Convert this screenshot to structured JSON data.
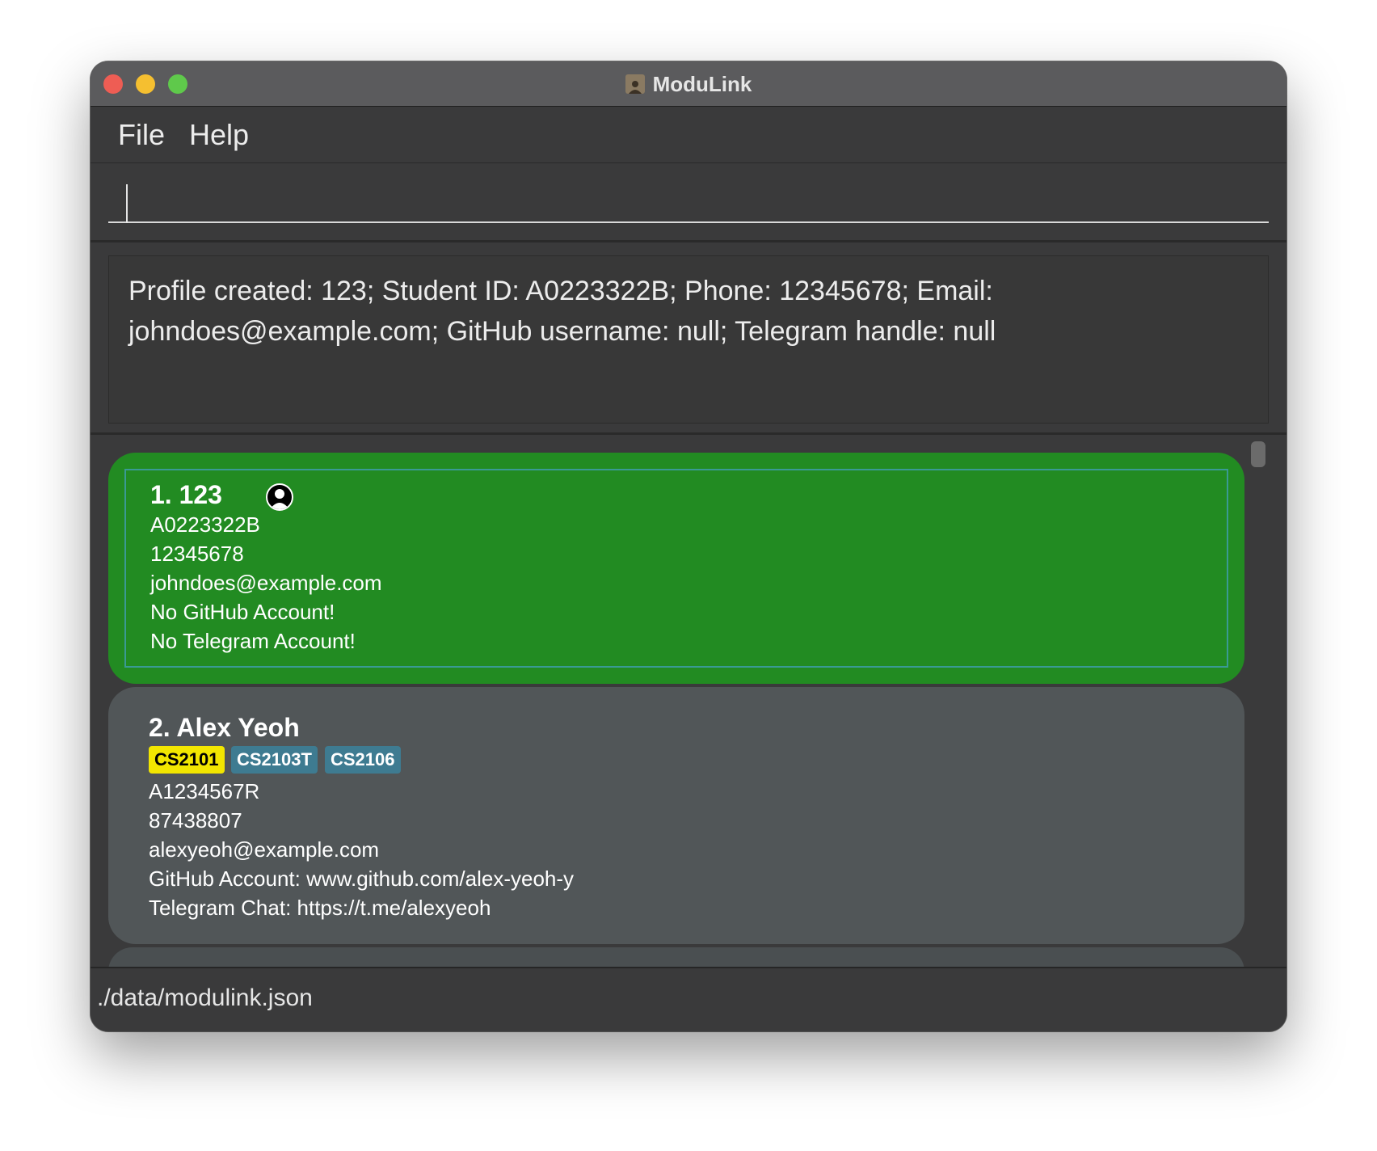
{
  "window": {
    "title": "ModuLink",
    "app_icon": "contact-book-icon"
  },
  "menu": {
    "items": [
      {
        "label": "File"
      },
      {
        "label": "Help"
      }
    ]
  },
  "command": {
    "value": "",
    "placeholder": ""
  },
  "result": {
    "text": "Profile created: 123; Student ID: A0223322B; Phone: 12345678; Email: johndoes@example.com; GitHub username: null; Telegram handle: null"
  },
  "persons": [
    {
      "name": "1. 123",
      "is_profile": true,
      "icon": "profile-person-icon",
      "tags": [],
      "student_id": "A0223322B",
      "phone": "12345678",
      "email": "johndoes@example.com",
      "github": "No GitHub Account!",
      "telegram": "No Telegram Account!",
      "selected": true
    },
    {
      "name": "2. Alex Yeoh",
      "is_profile": false,
      "tags": [
        {
          "label": "CS2101",
          "color": "#f2e600",
          "text_color": "#000000"
        },
        {
          "label": "CS2103T",
          "color": "#3e7b91",
          "text_color": "#ffffff"
        },
        {
          "label": "CS2106",
          "color": "#3e7b91",
          "text_color": "#ffffff"
        }
      ],
      "student_id": "A1234567R",
      "phone": "87438807",
      "email": "alexyeoh@example.com",
      "github": "GitHub Account: www.github.com/alex-yeoh-y",
      "telegram": "Telegram Chat: https://t.me/alexyeoh",
      "selected": false
    }
  ],
  "status": {
    "file_path": "./data/modulink.json"
  },
  "colors": {
    "selected_card": "#228b22",
    "card": "#515658",
    "background": "#3a3a3b"
  }
}
